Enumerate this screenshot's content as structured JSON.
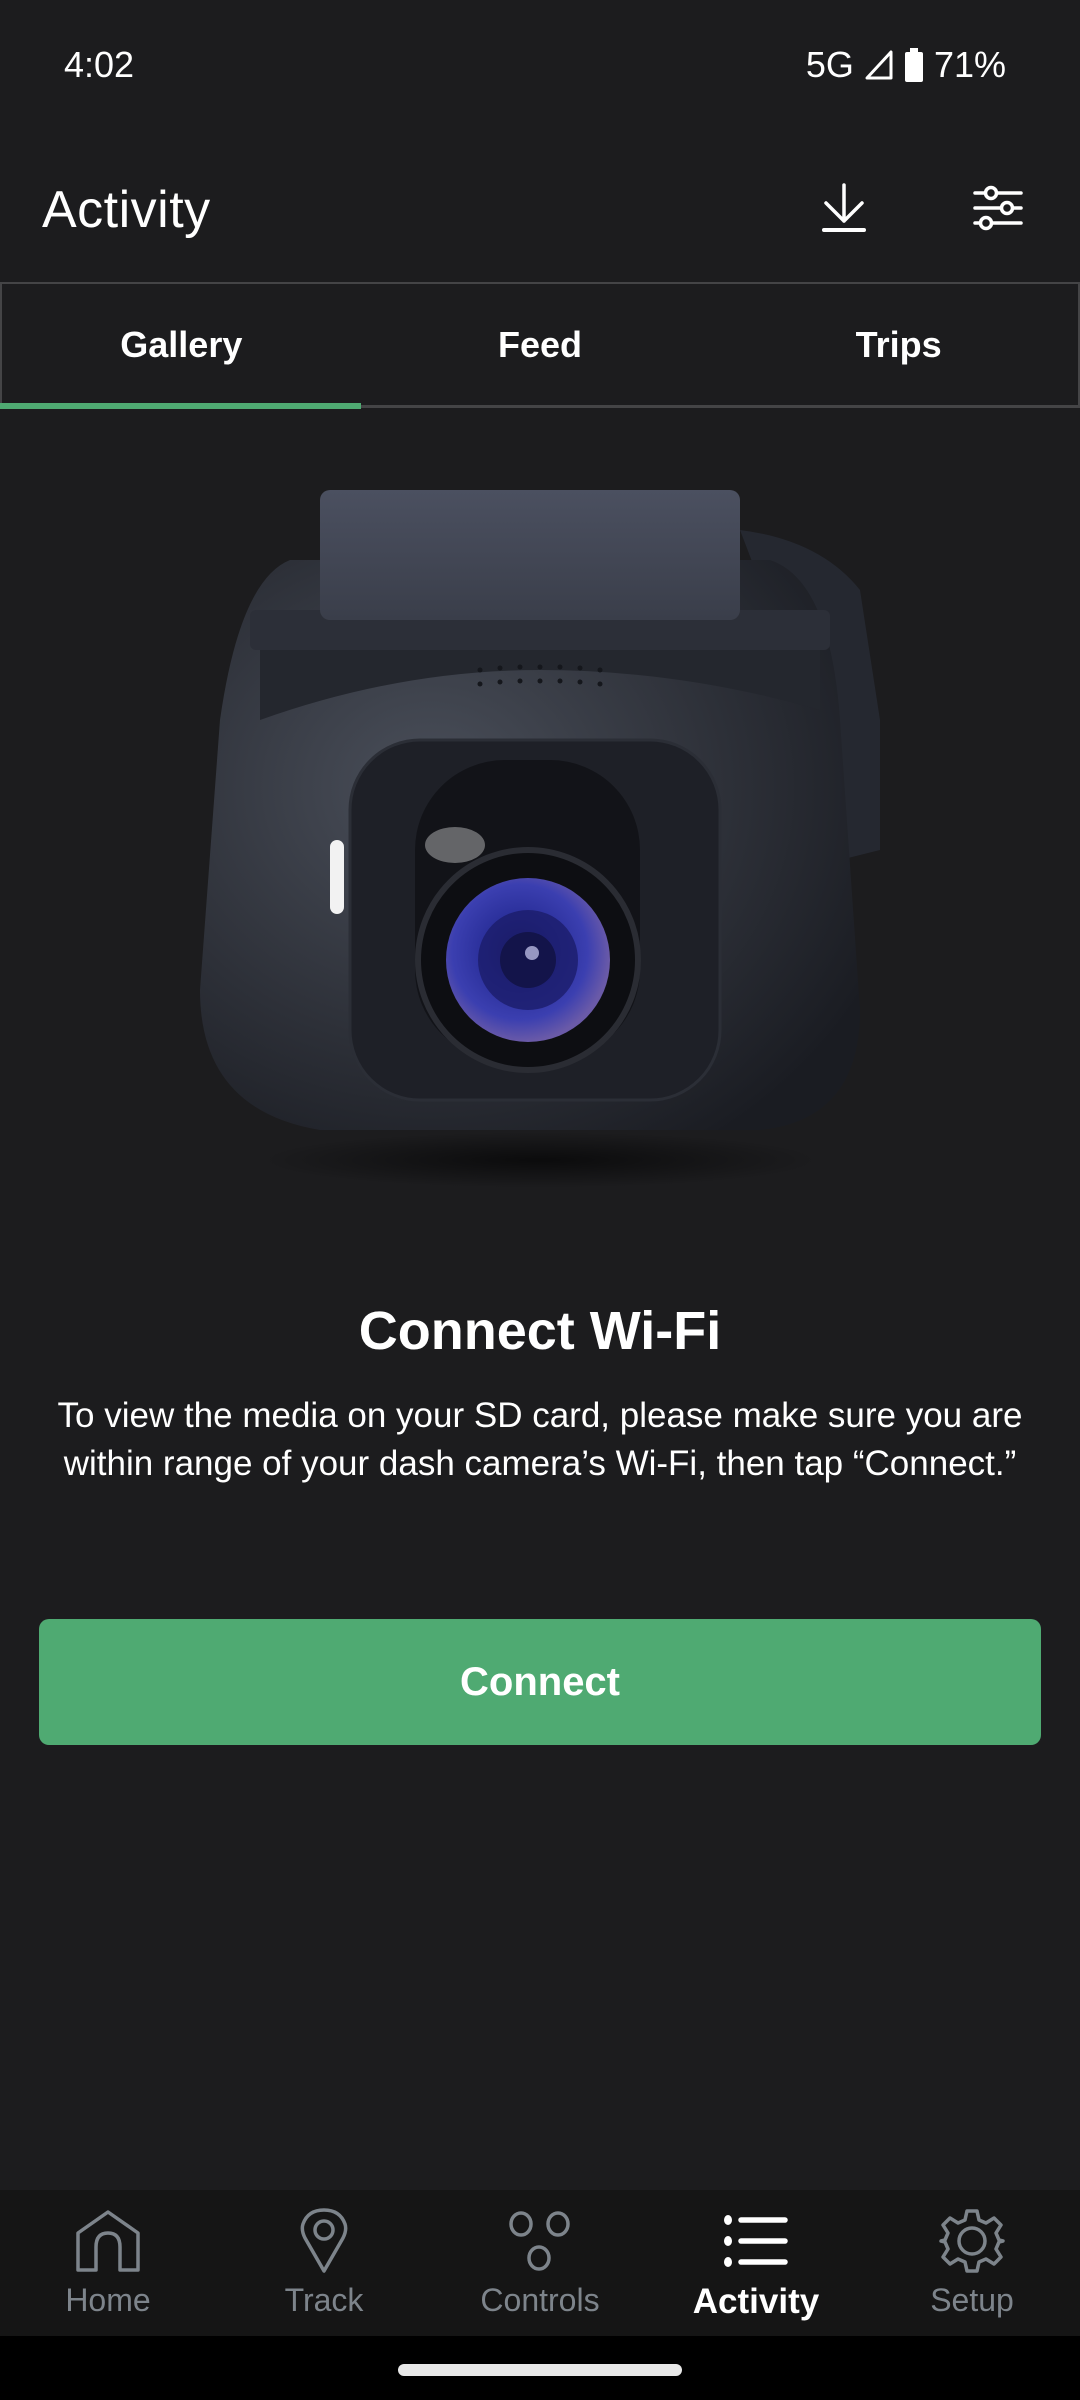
{
  "status_bar": {
    "time": "4:02",
    "network": "5G",
    "signal_icon": "cell-signal-icon",
    "battery_icon": "battery-icon",
    "battery_percent": "71%"
  },
  "header": {
    "title": "Activity",
    "actions": [
      {
        "name": "download",
        "icon": "download-icon"
      },
      {
        "name": "filter",
        "icon": "sliders-icon"
      }
    ]
  },
  "tabs": [
    {
      "label": "Gallery",
      "active": true
    },
    {
      "label": "Feed",
      "active": false
    },
    {
      "label": "Trips",
      "active": false
    }
  ],
  "hero": {
    "image": "dash-camera-image"
  },
  "message": {
    "title": "Connect Wi-Fi",
    "body": "To view the media on your SD card, please make sure you are within range of your dash camera’s Wi-Fi, then tap “Connect.”",
    "button_label": "Connect"
  },
  "bottom_nav": [
    {
      "label": "Home",
      "icon": "home-icon",
      "active": false
    },
    {
      "label": "Track",
      "icon": "location-pin-icon",
      "active": false
    },
    {
      "label": "Controls",
      "icon": "controls-icon",
      "active": false
    },
    {
      "label": "Activity",
      "icon": "list-icon",
      "active": true
    },
    {
      "label": "Setup",
      "icon": "gear-icon",
      "active": false
    }
  ],
  "colors": {
    "background": "#1c1c1e",
    "accent": "#4faa72",
    "nav_background": "#151515",
    "nav_inactive": "#7d848b",
    "text": "#ffffff"
  }
}
